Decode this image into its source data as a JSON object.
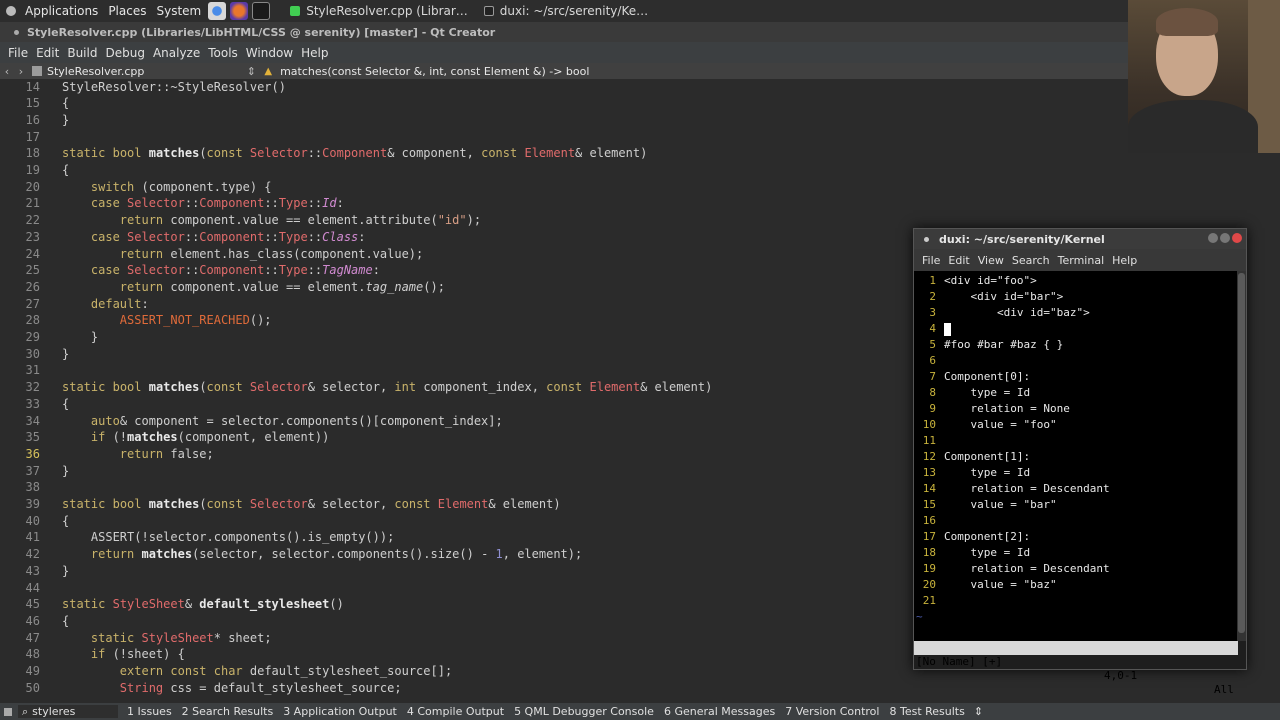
{
  "top_panel": {
    "menus": [
      "Applications",
      "Places",
      "System"
    ],
    "tasks": [
      {
        "label": "StyleResolver.cpp (Librar…",
        "icon": "qt-creator-icon"
      },
      {
        "label": "duxi: ~/src/serenity/Ke…",
        "icon": "terminal-icon"
      }
    ]
  },
  "qt_window": {
    "title": "StyleResolver.cpp (Libraries/LibHTML/CSS @ serenity) [master] - Qt Creator"
  },
  "menubar": [
    "File",
    "Edit",
    "Build",
    "Debug",
    "Analyze",
    "Tools",
    "Window",
    "Help"
  ],
  "toolbar": {
    "file_name": "StyleResolver.cpp",
    "function_signature": "matches(const Selector &, int, const Element &) -> bool"
  },
  "editor": {
    "current_line": 36,
    "lines": [
      {
        "n": 14,
        "text": "StyleResolver::~StyleResolver()"
      },
      {
        "n": 15,
        "text": "{"
      },
      {
        "n": 16,
        "text": "}"
      },
      {
        "n": 17,
        "text": ""
      },
      {
        "n": 18,
        "text": "static bool matches(const Selector::Component& component, const Element& element)"
      },
      {
        "n": 19,
        "text": "{"
      },
      {
        "n": 20,
        "text": "    switch (component.type) {"
      },
      {
        "n": 21,
        "text": "    case Selector::Component::Type::Id:"
      },
      {
        "n": 22,
        "text": "        return component.value == element.attribute(\"id\");"
      },
      {
        "n": 23,
        "text": "    case Selector::Component::Type::Class:"
      },
      {
        "n": 24,
        "text": "        return element.has_class(component.value);"
      },
      {
        "n": 25,
        "text": "    case Selector::Component::Type::TagName:"
      },
      {
        "n": 26,
        "text": "        return component.value == element.tag_name();"
      },
      {
        "n": 27,
        "text": "    default:"
      },
      {
        "n": 28,
        "text": "        ASSERT_NOT_REACHED();"
      },
      {
        "n": 29,
        "text": "    }"
      },
      {
        "n": 30,
        "text": "}"
      },
      {
        "n": 31,
        "text": ""
      },
      {
        "n": 32,
        "text": "static bool matches(const Selector& selector, int component_index, const Element& element)"
      },
      {
        "n": 33,
        "text": "{"
      },
      {
        "n": 34,
        "text": "    auto& component = selector.components()[component_index];"
      },
      {
        "n": 35,
        "text": "    if (!matches(component, element))"
      },
      {
        "n": 36,
        "text": "        return false;"
      },
      {
        "n": 37,
        "text": "}"
      },
      {
        "n": 38,
        "text": ""
      },
      {
        "n": 39,
        "text": "static bool matches(const Selector& selector, const Element& element)"
      },
      {
        "n": 40,
        "text": "{"
      },
      {
        "n": 41,
        "text": "    ASSERT(!selector.components().is_empty());"
      },
      {
        "n": 42,
        "text": "    return matches(selector, selector.components().size() - 1, element);"
      },
      {
        "n": 43,
        "text": "}"
      },
      {
        "n": 44,
        "text": ""
      },
      {
        "n": 45,
        "text": "static StyleSheet& default_stylesheet()"
      },
      {
        "n": 46,
        "text": "{"
      },
      {
        "n": 47,
        "text": "    static StyleSheet* sheet;"
      },
      {
        "n": 48,
        "text": "    if (!sheet) {"
      },
      {
        "n": 49,
        "text": "        extern const char default_stylesheet_source[];"
      },
      {
        "n": 50,
        "text": "        String css = default_stylesheet_source;"
      }
    ]
  },
  "terminal": {
    "title": "duxi: ~/src/serenity/Kernel",
    "menu": [
      "File",
      "Edit",
      "View",
      "Search",
      "Terminal",
      "Help"
    ],
    "lines": [
      {
        "n": "1",
        "text": "<div id=\"foo\">"
      },
      {
        "n": "2",
        "text": "    <div id=\"bar\">"
      },
      {
        "n": "3",
        "text": "        <div id=\"baz\">"
      },
      {
        "n": "4",
        "text": ""
      },
      {
        "n": "5",
        "text": "#foo #bar #baz { }"
      },
      {
        "n": "6",
        "text": ""
      },
      {
        "n": "7",
        "text": "Component[0]:"
      },
      {
        "n": "8",
        "text": "    type = Id"
      },
      {
        "n": "9",
        "text": "    relation = None"
      },
      {
        "n": "10",
        "text": "    value = \"foo\""
      },
      {
        "n": "11",
        "text": ""
      },
      {
        "n": "12",
        "text": "Component[1]:"
      },
      {
        "n": "13",
        "text": "    type = Id"
      },
      {
        "n": "14",
        "text": "    relation = Descendant"
      },
      {
        "n": "15",
        "text": "    value = \"bar\""
      },
      {
        "n": "16",
        "text": ""
      },
      {
        "n": "17",
        "text": "Component[2]:"
      },
      {
        "n": "18",
        "text": "    type = Id"
      },
      {
        "n": "19",
        "text": "    relation = Descendant"
      },
      {
        "n": "20",
        "text": "    value = \"baz\""
      },
      {
        "n": "21",
        "text": ""
      }
    ],
    "tilde": "~",
    "status_left": "[No Name] [+]",
    "status_pos": "4,0-1",
    "status_right": "All"
  },
  "statusbar": {
    "search_text": "styleres",
    "panes": [
      "1 Issues",
      "2 Search Results",
      "3 Application Output",
      "4 Compile Output",
      "5 QML Debugger Console",
      "6 General Messages",
      "7 Version Control",
      "8 Test Results"
    ]
  },
  "colors": {
    "keyword": "#c9b36a",
    "type": "#e06b6b",
    "function": "#e8e8e8",
    "enum": "#d08ad0",
    "string": "#d69d85",
    "macro": "#e06b3a",
    "number": "#8f8fd0"
  }
}
